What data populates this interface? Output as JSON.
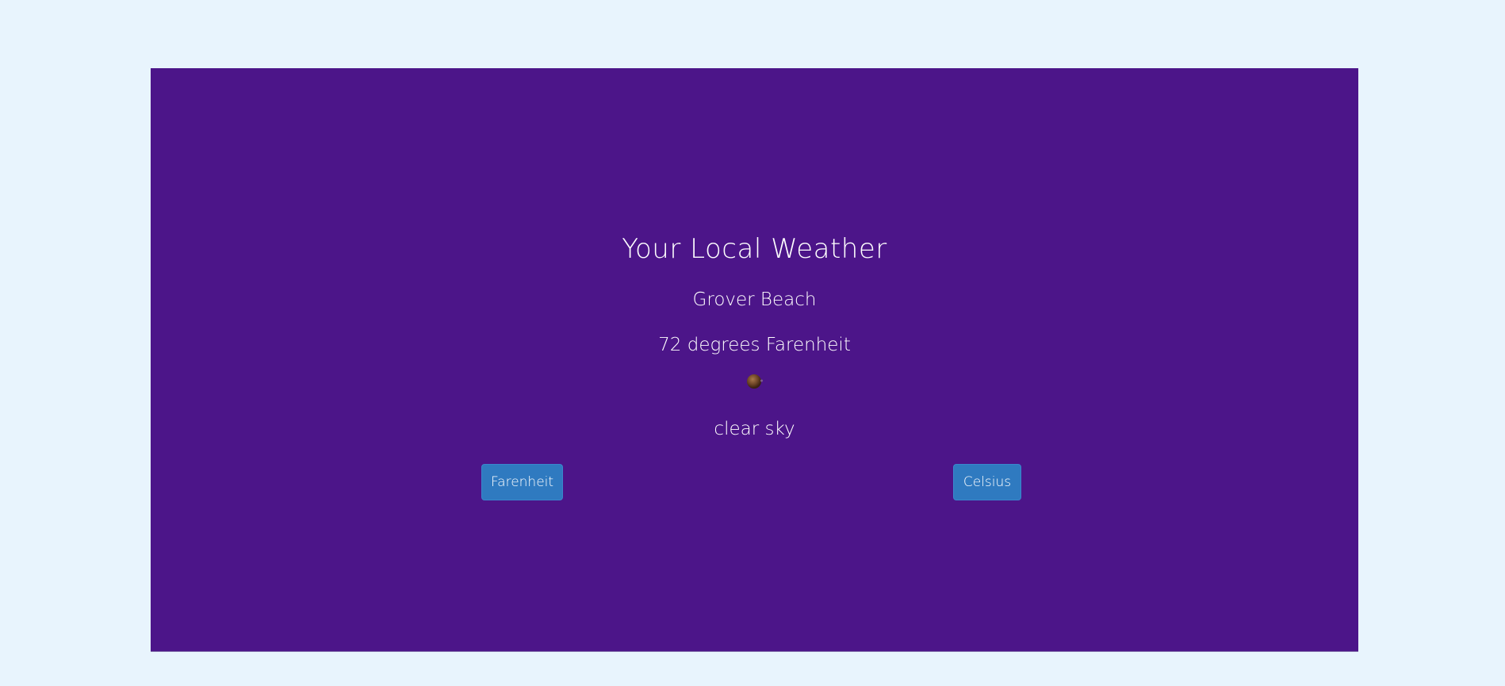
{
  "app": {
    "title": "Your Local Weather",
    "city": "Grover Beach",
    "temperature_text": "72 degrees Farenheit",
    "weather_icon": "clear-sky-icon",
    "description": "clear sky"
  },
  "buttons": {
    "farenheit_label": "Farenheit",
    "celsius_label": "Celsius"
  },
  "colors": {
    "page_background": "#e8f4fd",
    "panel_background": "#4c1589",
    "button_background": "#2f7ac0",
    "text": "#ffffff"
  }
}
